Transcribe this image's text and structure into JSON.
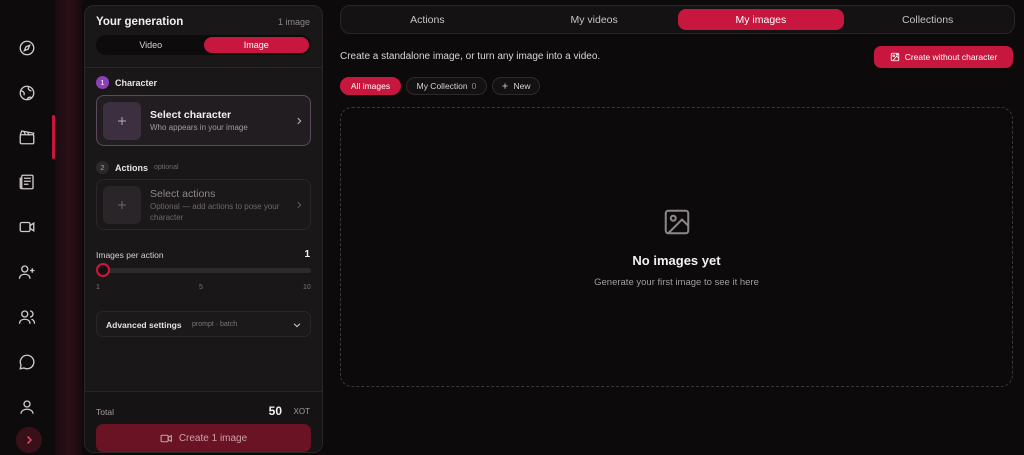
{
  "rail": {
    "icons": [
      "compass-icon",
      "globe-icon",
      "clapperboard-icon",
      "newspaper-icon",
      "video-icon",
      "user-plus-icon",
      "users-icon",
      "chat-icon",
      "user-icon"
    ],
    "expand_icon": "chevron-right-icon"
  },
  "panel": {
    "title": "Your generation",
    "count": "1 image",
    "mode_tabs": [
      {
        "label": "Video",
        "active": false
      },
      {
        "label": "Image",
        "active": true
      }
    ],
    "step1": {
      "number": "1",
      "label": "Character",
      "card_title": "Select character",
      "card_sub": "Who appears in your image"
    },
    "step2": {
      "number": "2",
      "label": "Actions",
      "optional": "optional",
      "card_title": "Select actions",
      "card_sub": "Optional — add actions to pose your character"
    },
    "images_per_action": {
      "label": "Images per action",
      "value": "1",
      "level": 1,
      "min": 1,
      "max": 10,
      "ticks": [
        "1",
        "5",
        "10"
      ]
    },
    "advanced": {
      "title": "Advanced settings",
      "sub": "prompt · batch"
    },
    "footer": {
      "total_label": "Total",
      "total_value": "50",
      "total_unit": "XOT",
      "create_label": "Create 1 image"
    }
  },
  "main": {
    "tabs": [
      {
        "label": "Actions",
        "active": false
      },
      {
        "label": "My videos",
        "active": false
      },
      {
        "label": "My images",
        "active": true
      },
      {
        "label": "Collections",
        "active": false
      }
    ],
    "subtitle": "Create a standalone image, or turn any image into a video.",
    "cta_label": "Create without character",
    "chips": {
      "all_images": "All images",
      "my_collection": "My Collection",
      "my_collection_count": "0",
      "new": "New"
    },
    "empty": {
      "title": "No images yet",
      "sub": "Generate your first image to see it here"
    }
  },
  "colors": {
    "accent": "#c8173e",
    "background": "#0c0a0b",
    "panel": "#1a1718"
  }
}
